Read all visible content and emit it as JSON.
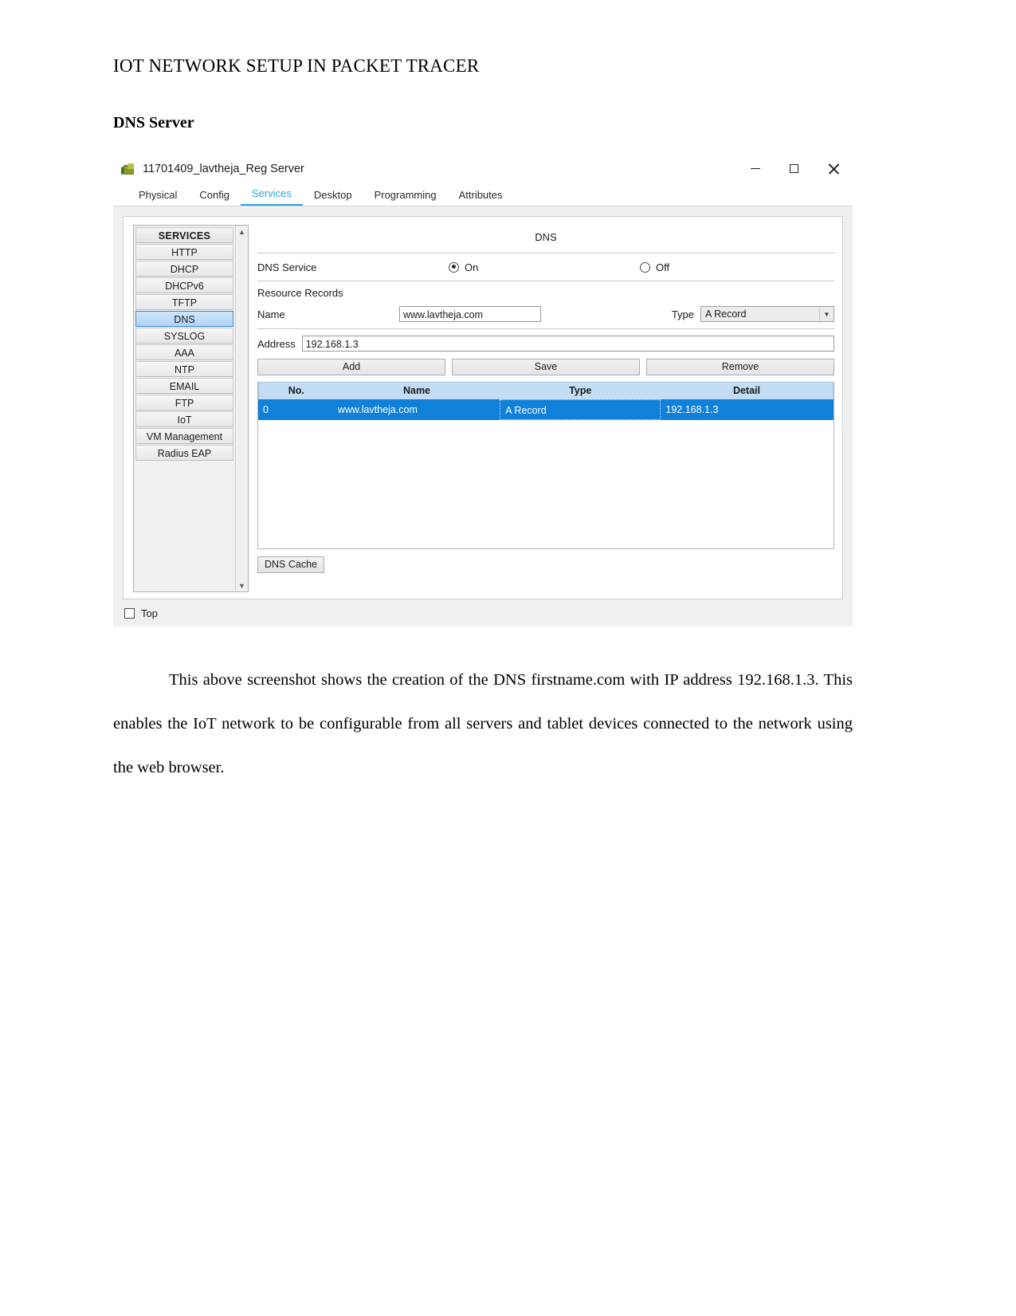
{
  "document": {
    "title": "IOT NETWORK SETUP IN PACKET TRACER",
    "subtitle": "DNS Server",
    "paragraph": "This above screenshot shows the creation of the DNS firstname.com with IP address 192.168.1.3. This enables the IoT network to be configurable from all servers and tablet devices connected to the network using the web browser."
  },
  "window": {
    "title": "11701409_lavtheja_Reg Server",
    "controls": {
      "minimize": "minimize-icon",
      "maximize": "maximize-icon",
      "close": "close-icon"
    },
    "tabs": [
      {
        "label": "Physical",
        "active": false
      },
      {
        "label": "Config",
        "active": false
      },
      {
        "label": "Services",
        "active": true
      },
      {
        "label": "Desktop",
        "active": false
      },
      {
        "label": "Programming",
        "active": false
      },
      {
        "label": "Attributes",
        "active": false
      }
    ],
    "active_tab": "Services",
    "accent_color": "#2ba8dd"
  },
  "services": {
    "header": "SERVICES",
    "items": [
      {
        "label": "HTTP",
        "selected": false
      },
      {
        "label": "DHCP",
        "selected": false
      },
      {
        "label": "DHCPv6",
        "selected": false
      },
      {
        "label": "TFTP",
        "selected": false
      },
      {
        "label": "DNS",
        "selected": true
      },
      {
        "label": "SYSLOG",
        "selected": false
      },
      {
        "label": "AAA",
        "selected": false
      },
      {
        "label": "NTP",
        "selected": false
      },
      {
        "label": "EMAIL",
        "selected": false
      },
      {
        "label": "FTP",
        "selected": false
      },
      {
        "label": "IoT",
        "selected": false
      },
      {
        "label": "VM Management",
        "selected": false
      },
      {
        "label": "Radius EAP",
        "selected": false
      }
    ],
    "scroll_up_icon": "chevron-up-icon",
    "scroll_down_icon": "chevron-down-icon",
    "selected_color": "#aed4f5"
  },
  "dns": {
    "pane_title": "DNS",
    "service_label": "DNS Service",
    "radio_on_label": "On",
    "radio_off_label": "Off",
    "service_state": "On",
    "resource_records_label": "Resource Records",
    "name_label": "Name",
    "name_value": "www.lavtheja.com",
    "type_label": "Type",
    "type_value": "A Record",
    "type_arrow_icon": "chevron-down-icon",
    "address_label": "Address",
    "address_value": "192.168.1.3",
    "buttons": {
      "add": "Add",
      "save": "Save",
      "remove": "Remove"
    },
    "table": {
      "columns": [
        "No.",
        "Name",
        "Type",
        "Detail"
      ],
      "rows": [
        {
          "no": "0",
          "name": "www.lavtheja.com",
          "type": "A Record",
          "detail": "192.168.1.3"
        }
      ],
      "header_color": "#c2ddf4",
      "selected_row_color": "#1180d8"
    },
    "cache_button": "DNS Cache"
  },
  "footer": {
    "top_checkbox_label": "Top",
    "top_checked": false
  }
}
